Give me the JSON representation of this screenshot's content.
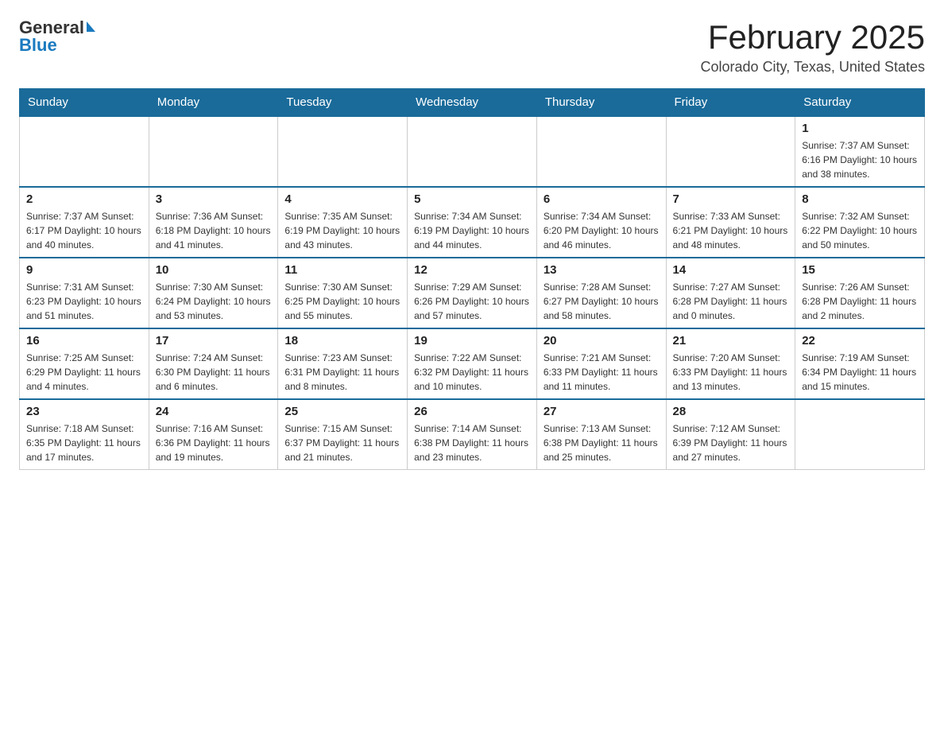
{
  "header": {
    "logo_general": "General",
    "logo_blue": "Blue",
    "title": "February 2025",
    "location": "Colorado City, Texas, United States"
  },
  "weekdays": [
    "Sunday",
    "Monday",
    "Tuesday",
    "Wednesday",
    "Thursday",
    "Friday",
    "Saturday"
  ],
  "weeks": [
    [
      {
        "day": "",
        "info": ""
      },
      {
        "day": "",
        "info": ""
      },
      {
        "day": "",
        "info": ""
      },
      {
        "day": "",
        "info": ""
      },
      {
        "day": "",
        "info": ""
      },
      {
        "day": "",
        "info": ""
      },
      {
        "day": "1",
        "info": "Sunrise: 7:37 AM\nSunset: 6:16 PM\nDaylight: 10 hours\nand 38 minutes."
      }
    ],
    [
      {
        "day": "2",
        "info": "Sunrise: 7:37 AM\nSunset: 6:17 PM\nDaylight: 10 hours\nand 40 minutes."
      },
      {
        "day": "3",
        "info": "Sunrise: 7:36 AM\nSunset: 6:18 PM\nDaylight: 10 hours\nand 41 minutes."
      },
      {
        "day": "4",
        "info": "Sunrise: 7:35 AM\nSunset: 6:19 PM\nDaylight: 10 hours\nand 43 minutes."
      },
      {
        "day": "5",
        "info": "Sunrise: 7:34 AM\nSunset: 6:19 PM\nDaylight: 10 hours\nand 44 minutes."
      },
      {
        "day": "6",
        "info": "Sunrise: 7:34 AM\nSunset: 6:20 PM\nDaylight: 10 hours\nand 46 minutes."
      },
      {
        "day": "7",
        "info": "Sunrise: 7:33 AM\nSunset: 6:21 PM\nDaylight: 10 hours\nand 48 minutes."
      },
      {
        "day": "8",
        "info": "Sunrise: 7:32 AM\nSunset: 6:22 PM\nDaylight: 10 hours\nand 50 minutes."
      }
    ],
    [
      {
        "day": "9",
        "info": "Sunrise: 7:31 AM\nSunset: 6:23 PM\nDaylight: 10 hours\nand 51 minutes."
      },
      {
        "day": "10",
        "info": "Sunrise: 7:30 AM\nSunset: 6:24 PM\nDaylight: 10 hours\nand 53 minutes."
      },
      {
        "day": "11",
        "info": "Sunrise: 7:30 AM\nSunset: 6:25 PM\nDaylight: 10 hours\nand 55 minutes."
      },
      {
        "day": "12",
        "info": "Sunrise: 7:29 AM\nSunset: 6:26 PM\nDaylight: 10 hours\nand 57 minutes."
      },
      {
        "day": "13",
        "info": "Sunrise: 7:28 AM\nSunset: 6:27 PM\nDaylight: 10 hours\nand 58 minutes."
      },
      {
        "day": "14",
        "info": "Sunrise: 7:27 AM\nSunset: 6:28 PM\nDaylight: 11 hours\nand 0 minutes."
      },
      {
        "day": "15",
        "info": "Sunrise: 7:26 AM\nSunset: 6:28 PM\nDaylight: 11 hours\nand 2 minutes."
      }
    ],
    [
      {
        "day": "16",
        "info": "Sunrise: 7:25 AM\nSunset: 6:29 PM\nDaylight: 11 hours\nand 4 minutes."
      },
      {
        "day": "17",
        "info": "Sunrise: 7:24 AM\nSunset: 6:30 PM\nDaylight: 11 hours\nand 6 minutes."
      },
      {
        "day": "18",
        "info": "Sunrise: 7:23 AM\nSunset: 6:31 PM\nDaylight: 11 hours\nand 8 minutes."
      },
      {
        "day": "19",
        "info": "Sunrise: 7:22 AM\nSunset: 6:32 PM\nDaylight: 11 hours\nand 10 minutes."
      },
      {
        "day": "20",
        "info": "Sunrise: 7:21 AM\nSunset: 6:33 PM\nDaylight: 11 hours\nand 11 minutes."
      },
      {
        "day": "21",
        "info": "Sunrise: 7:20 AM\nSunset: 6:33 PM\nDaylight: 11 hours\nand 13 minutes."
      },
      {
        "day": "22",
        "info": "Sunrise: 7:19 AM\nSunset: 6:34 PM\nDaylight: 11 hours\nand 15 minutes."
      }
    ],
    [
      {
        "day": "23",
        "info": "Sunrise: 7:18 AM\nSunset: 6:35 PM\nDaylight: 11 hours\nand 17 minutes."
      },
      {
        "day": "24",
        "info": "Sunrise: 7:16 AM\nSunset: 6:36 PM\nDaylight: 11 hours\nand 19 minutes."
      },
      {
        "day": "25",
        "info": "Sunrise: 7:15 AM\nSunset: 6:37 PM\nDaylight: 11 hours\nand 21 minutes."
      },
      {
        "day": "26",
        "info": "Sunrise: 7:14 AM\nSunset: 6:38 PM\nDaylight: 11 hours\nand 23 minutes."
      },
      {
        "day": "27",
        "info": "Sunrise: 7:13 AM\nSunset: 6:38 PM\nDaylight: 11 hours\nand 25 minutes."
      },
      {
        "day": "28",
        "info": "Sunrise: 7:12 AM\nSunset: 6:39 PM\nDaylight: 11 hours\nand 27 minutes."
      },
      {
        "day": "",
        "info": ""
      }
    ]
  ]
}
